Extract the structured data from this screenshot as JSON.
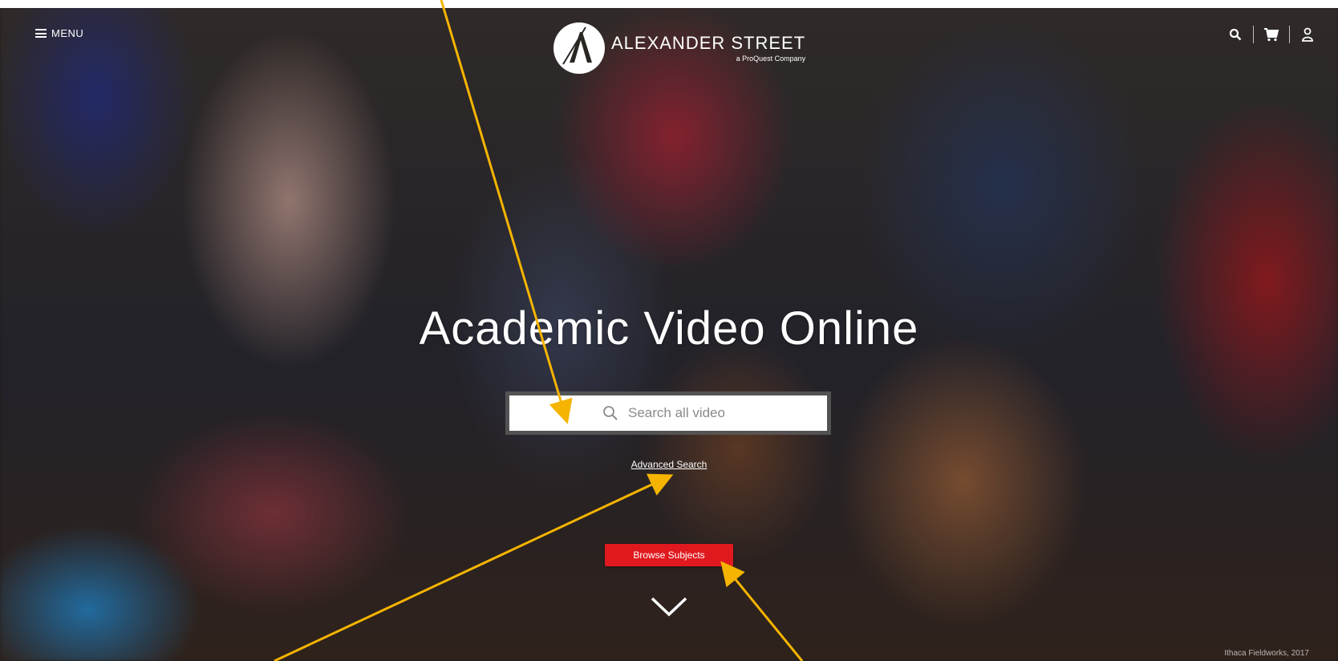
{
  "header": {
    "menu_label": "MENU",
    "brand_name": "ALEXANDER STREET",
    "brand_sub": "a ProQuest Company"
  },
  "hero": {
    "title": "Academic Video Online",
    "search_placeholder": "Search all video",
    "advanced_search_label": "Advanced Search",
    "browse_button_label": "Browse Subjects",
    "photo_credit": "Ithaca Fieldworks, 2017"
  },
  "icons": {
    "menu": "hamburger-icon",
    "search": "search-icon",
    "cart": "cart-icon",
    "user": "user-icon",
    "scroll": "chevron-down-icon"
  },
  "colors": {
    "accent_red": "#e0191f",
    "annotation_arrow": "#f5b400",
    "text": "#ffffff"
  }
}
